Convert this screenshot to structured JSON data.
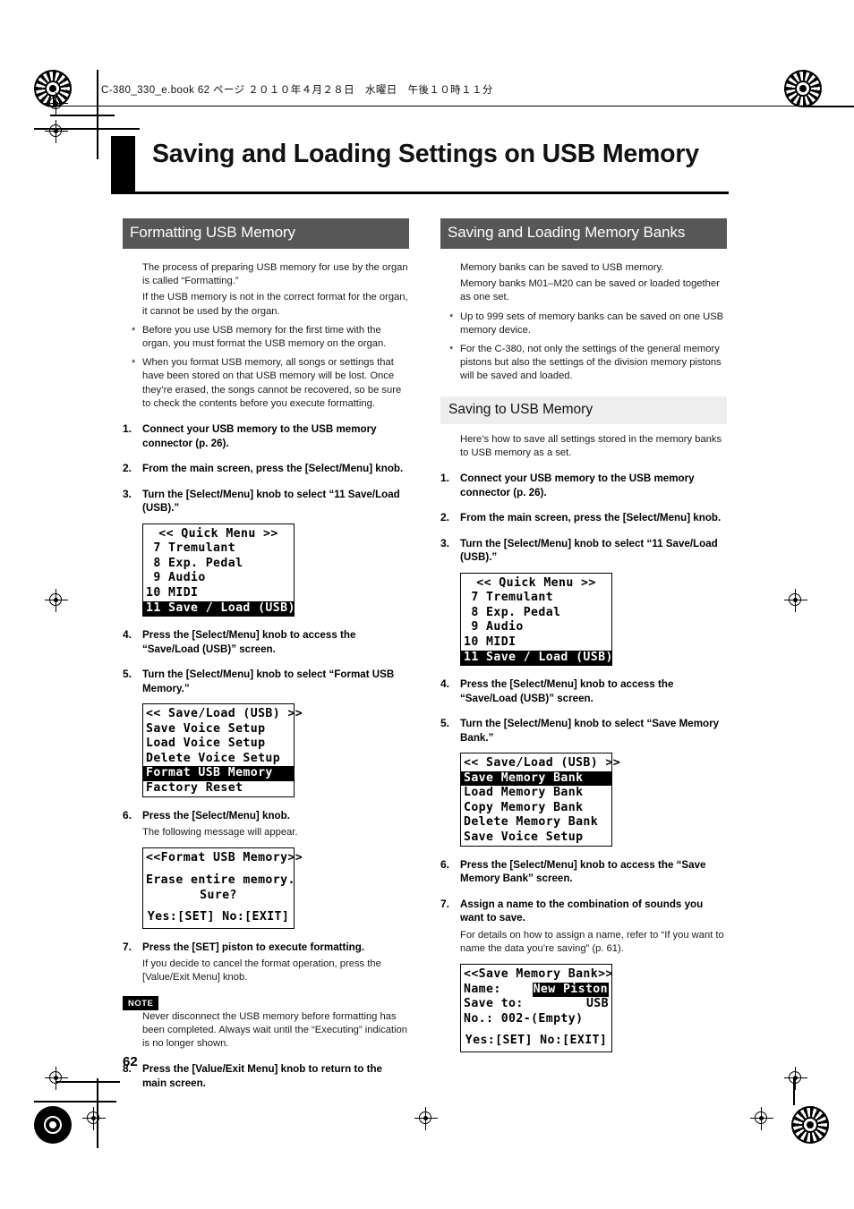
{
  "book_header": "C-380_330_e.book  62 ページ  ２０１０年４月２８日　水曜日　午後１０時１１分",
  "page_number": "62",
  "chapter_title": "Saving and Loading Settings on USB Memory",
  "colors": {
    "section_head_bg": "#575757",
    "sub_head_bg": "#eeeeee",
    "rule": "#000000"
  },
  "left_column": {
    "section_title": "Formatting USB Memory",
    "intro": [
      "The process of preparing USB memory for use by the organ is called “Formatting.”",
      "If the USB memory is not in the correct format for the organ, it cannot be used by the organ."
    ],
    "notes": [
      "Before you use USB memory for the first time with the organ, you must format the USB memory on the organ.",
      "When you format USB memory, all songs or settings that have been stored on that USB memory will be lost. Once they’re erased, the songs cannot be recovered, so be sure to check the contents before you execute formatting."
    ],
    "steps": [
      {
        "num": "1.",
        "text": "Connect your USB memory to the USB memory connector (p. 26)."
      },
      {
        "num": "2.",
        "text": "From the main screen, press the [Select/Menu] knob."
      },
      {
        "num": "3.",
        "text": "Turn the [Select/Menu] knob to select “11 Save/Load (USB).”"
      },
      {
        "num": "4.",
        "text": "Press the [Select/Menu] knob to access the “Save/Load (USB)” screen."
      },
      {
        "num": "5.",
        "text": "Turn the [Select/Menu] knob to select “Format USB Memory.”"
      },
      {
        "num": "6.",
        "text": "Press the [Select/Menu] knob.",
        "sub": "The following message will appear."
      },
      {
        "num": "7.",
        "text": "Press the [SET] piston to execute formatting.",
        "sub": "If you decide to cancel the format operation, press the [Value/Exit Menu] knob."
      },
      {
        "num": "8.",
        "text": "Press the [Value/Exit Menu] knob to return to the main screen."
      }
    ],
    "note_block": {
      "tag": "NOTE",
      "text": "Never disconnect the USB memory before formatting has been completed. Always wait until the “Executing” indication is no longer shown."
    },
    "lcd_quick_menu": {
      "title": "<< Quick Menu >>",
      "items": [
        {
          "text": " 7 Tremulant",
          "selected": false
        },
        {
          "text": " 8 Exp. Pedal",
          "selected": false
        },
        {
          "text": " 9 Audio",
          "selected": false
        },
        {
          "text": "10 MIDI",
          "selected": false
        },
        {
          "text": "11 Save / Load (USB)",
          "selected": true
        }
      ]
    },
    "lcd_save_load": {
      "title": "<< Save/Load (USB) >>",
      "items": [
        {
          "text": "Save Voice Setup",
          "selected": false
        },
        {
          "text": "Load Voice Setup",
          "selected": false
        },
        {
          "text": "Delete Voice Setup",
          "selected": false
        },
        {
          "text": "Format USB Memory",
          "selected": true
        },
        {
          "text": "Factory Reset",
          "selected": false
        }
      ]
    },
    "lcd_format_confirm": {
      "title": "<<Format USB Memory>>",
      "line1": "Erase entire memory.",
      "line2": "Sure?",
      "prompt": "Yes:[SET] No:[EXIT]"
    }
  },
  "right_column": {
    "section_title": "Saving and Loading Memory Banks",
    "intro": [
      "Memory banks can be saved to USB memory.",
      "Memory banks M01–M20 can be saved or loaded together as one set."
    ],
    "notes": [
      "Up to 999 sets of memory banks can be saved on one USB memory device.",
      "For the C-380, not only the settings of the general memory pistons but also the settings of the division memory pistons will be saved and loaded."
    ],
    "sub_title": "Saving to USB Memory",
    "sub_intro": "Here’s how to save all settings stored in the memory banks to USB memory as a set.",
    "steps": [
      {
        "num": "1.",
        "text": "Connect your USB memory to the USB memory connector (p. 26)."
      },
      {
        "num": "2.",
        "text": "From the main screen, press the [Select/Menu] knob."
      },
      {
        "num": "3.",
        "text": "Turn the [Select/Menu] knob to select “11 Save/Load (USB).”"
      },
      {
        "num": "4.",
        "text": "Press the [Select/Menu] knob to access the “Save/Load (USB)” screen."
      },
      {
        "num": "5.",
        "text": "Turn the [Select/Menu] knob to select “Save Memory Bank.”"
      },
      {
        "num": "6.",
        "text": "Press the [Select/Menu] knob to access the “Save Memory Bank” screen."
      },
      {
        "num": "7.",
        "text": "Assign a name to the combination of sounds you want to save.",
        "sub": "For details on how to assign a name, refer to  “If you want to name the data you’re saving” (p. 61)."
      }
    ],
    "lcd_quick_menu": {
      "title": "<< Quick Menu >>",
      "items": [
        {
          "text": " 7 Tremulant",
          "selected": false
        },
        {
          "text": " 8 Exp. Pedal",
          "selected": false
        },
        {
          "text": " 9 Audio",
          "selected": false
        },
        {
          "text": "10 MIDI",
          "selected": false
        },
        {
          "text": "11 Save / Load (USB)",
          "selected": true
        }
      ]
    },
    "lcd_save_load": {
      "title": "<< Save/Load (USB) >>",
      "items": [
        {
          "text": "Save Memory Bank",
          "selected": true
        },
        {
          "text": "Load Memory Bank",
          "selected": false
        },
        {
          "text": "Copy Memory Bank",
          "selected": false
        },
        {
          "text": "Delete Memory Bank",
          "selected": false
        },
        {
          "text": "Save Voice Setup",
          "selected": false
        }
      ]
    },
    "lcd_save_memory_bank": {
      "title": "<<Save Memory Bank>>",
      "name_label": "Name:",
      "name_value": "New Piston",
      "saveto_label": "Save to:",
      "saveto_value": "USB",
      "no_line": "No.: 002-(Empty)",
      "prompt": "Yes:[SET] No:[EXIT]"
    }
  }
}
